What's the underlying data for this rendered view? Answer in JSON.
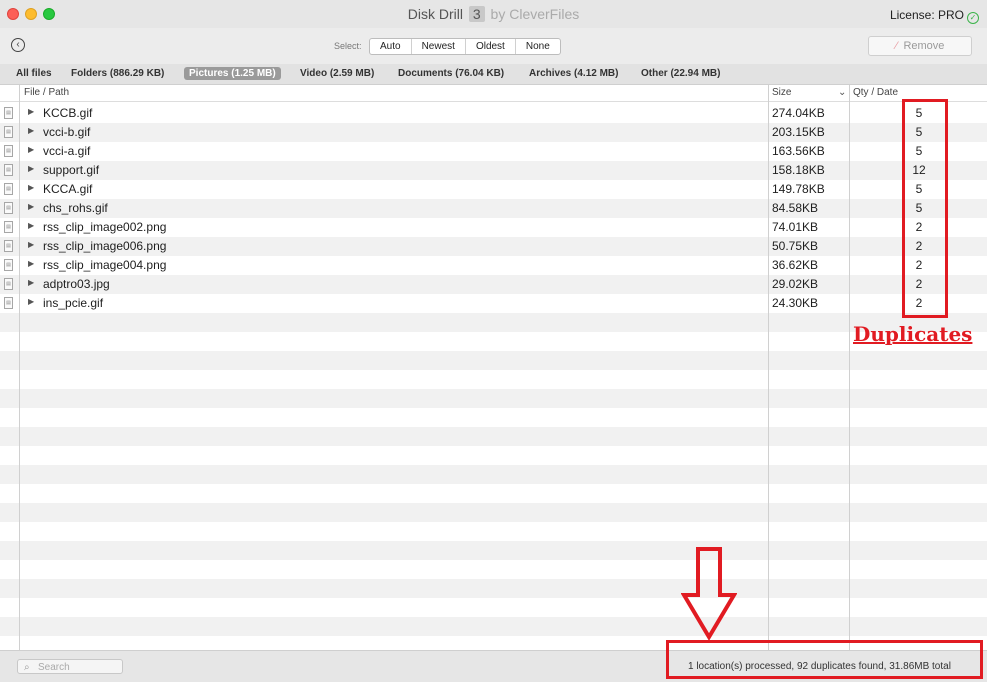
{
  "window": {
    "app_name": "Disk Drill",
    "version": "3",
    "by_label": "by CleverFiles",
    "license_text": "License: PRO"
  },
  "toolbar": {
    "select_label": "Select:",
    "select_options": [
      "Auto",
      "Newest",
      "Oldest",
      "None"
    ],
    "remove_label": "Remove"
  },
  "tabs": [
    {
      "label": "All files",
      "active": false
    },
    {
      "label": "Folders (886.29 KB)",
      "active": false
    },
    {
      "label": "Pictures (1.25 MB)",
      "active": true
    },
    {
      "label": "Video (2.59 MB)",
      "active": false
    },
    {
      "label": "Documents (76.04 KB)",
      "active": false
    },
    {
      "label": "Archives (4.12 MB)",
      "active": false
    },
    {
      "label": "Other (22.94 MB)",
      "active": false
    }
  ],
  "columns": {
    "path": "File / Path",
    "size": "Size",
    "qty_date": "Qty / Date"
  },
  "files": [
    {
      "name": "KCCB.gif",
      "size": "274.04KB",
      "qty": "5"
    },
    {
      "name": "vcci-b.gif",
      "size": "203.15KB",
      "qty": "5"
    },
    {
      "name": "vcci-a.gif",
      "size": "163.56KB",
      "qty": "5"
    },
    {
      "name": "support.gif",
      "size": "158.18KB",
      "qty": "12"
    },
    {
      "name": "KCCA.gif",
      "size": "149.78KB",
      "qty": "5"
    },
    {
      "name": "chs_rohs.gif",
      "size": "84.58KB",
      "qty": "5"
    },
    {
      "name": "rss_clip_image002.png",
      "size": "74.01KB",
      "qty": "2"
    },
    {
      "name": "rss_clip_image006.png",
      "size": "50.75KB",
      "qty": "2"
    },
    {
      "name": "rss_clip_image004.png",
      "size": "36.62KB",
      "qty": "2"
    },
    {
      "name": "adptro03.jpg",
      "size": "29.02KB",
      "qty": "2"
    },
    {
      "name": "ins_pcie.gif",
      "size": "24.30KB",
      "qty": "2"
    }
  ],
  "annotation": {
    "label": "Duplicates",
    "color": "#e11b22"
  },
  "status": {
    "search_placeholder": "Search",
    "summary": "1 location(s) processed, 92 duplicates found, 31.86MB total"
  }
}
